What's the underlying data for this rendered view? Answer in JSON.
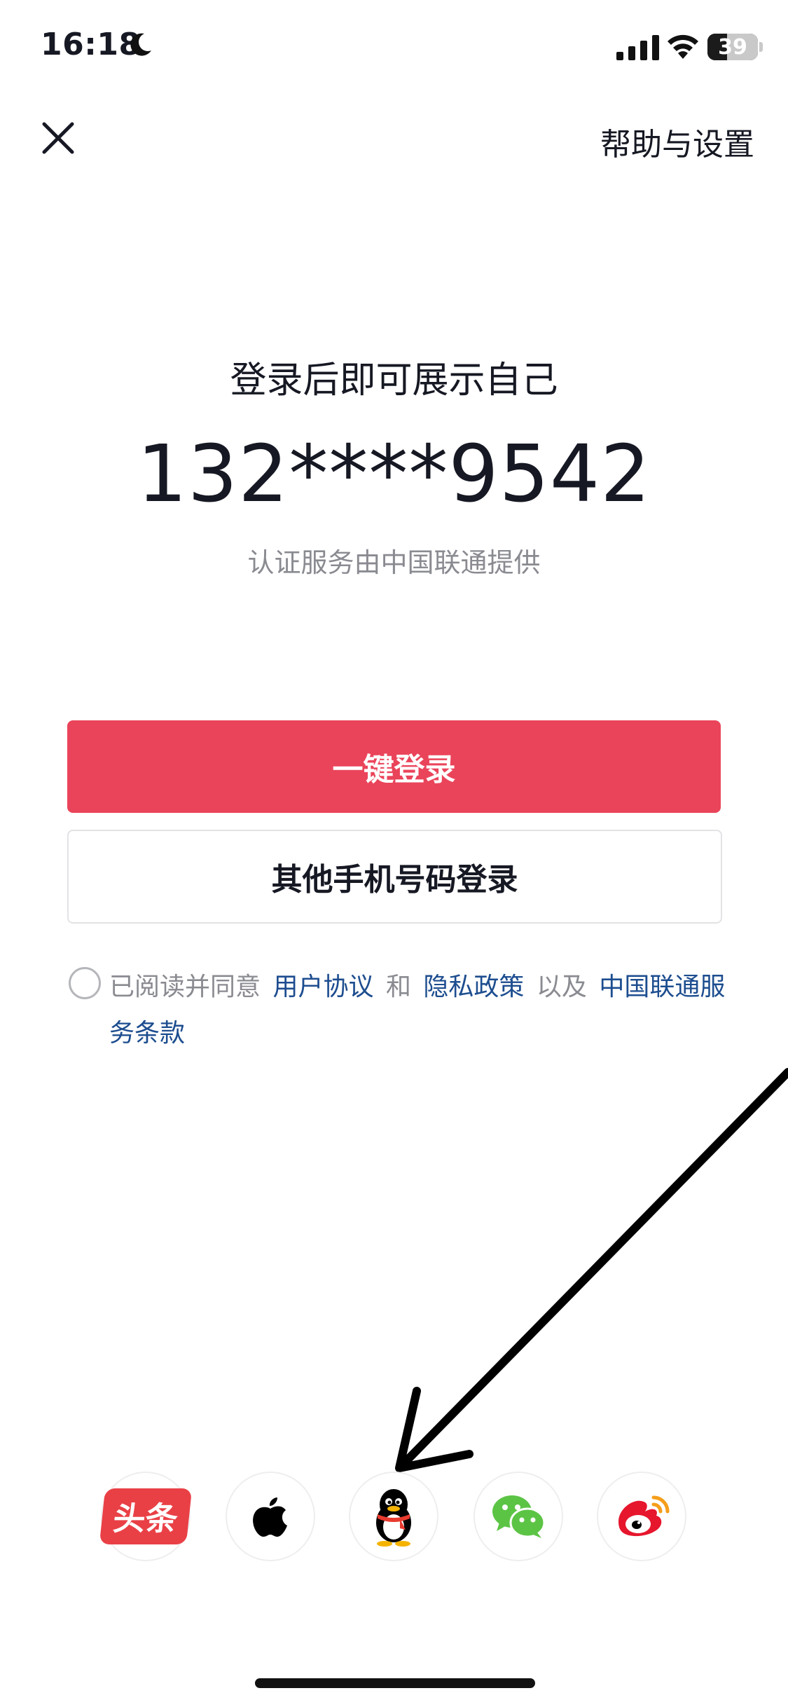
{
  "status_bar": {
    "time": "16:18",
    "battery": "39",
    "battery_level": 0.39
  },
  "nav": {
    "help_label": "帮助与设置"
  },
  "main": {
    "headline": "登录后即可展示自己",
    "phone": "132****9542",
    "provider": "认证服务由中国联通提供"
  },
  "buttons": {
    "one_tap_login": "一键登录",
    "other_phone_login": "其他手机号码登录"
  },
  "agreement": {
    "prefix": "已阅读并同意",
    "user_agreement": "用户协议",
    "and": "和",
    "privacy_policy": "隐私政策",
    "as_well_as": "以及",
    "carrier_terms": "中国联通服务条款"
  },
  "third_party": {
    "toutiao_label": "头条",
    "icons": [
      "toutiao-icon",
      "apple-icon",
      "qq-icon",
      "wechat-icon",
      "weibo-icon"
    ]
  },
  "colors": {
    "primary": "#ea445a",
    "link": "#1d4d8f",
    "muted": "#8a8b91",
    "text": "#161823"
  }
}
